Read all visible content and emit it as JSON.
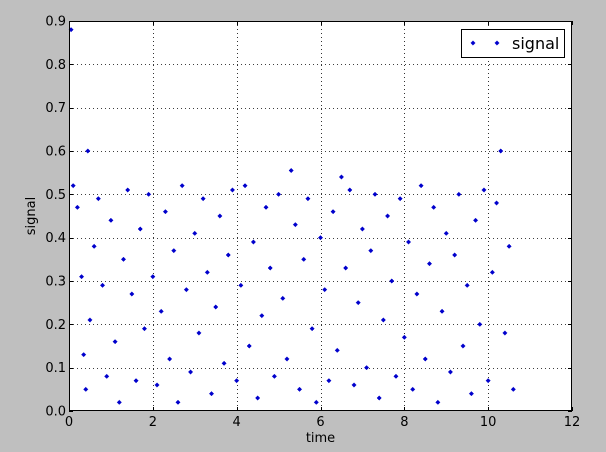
{
  "chart_data": {
    "type": "scatter",
    "xlabel": "time",
    "ylabel": "signal",
    "xlim": [
      0,
      12
    ],
    "ylim": [
      0,
      0.9
    ],
    "xticks": [
      "0",
      "2",
      "4",
      "6",
      "8",
      "10",
      "12"
    ],
    "yticks": [
      "0.0",
      "0.1",
      "0.2",
      "0.3",
      "0.4",
      "0.5",
      "0.6",
      "0.7",
      "0.8",
      "0.9"
    ],
    "grid": true,
    "legend_position": "top-right",
    "marker_color": "#0000cc",
    "series": [
      {
        "name": "signal",
        "marker": "diamond",
        "x_range": [
          0,
          10.65
        ],
        "notable_points": [
          {
            "x": 0.05,
            "y": 0.88
          },
          {
            "x": 0.45,
            "y": 0.6
          },
          {
            "x": 5.3,
            "y": 0.555
          },
          {
            "x": 6.5,
            "y": 0.54
          },
          {
            "x": 10.3,
            "y": 0.6
          }
        ],
        "samples": [
          {
            "x": 0.1,
            "y": 0.52
          },
          {
            "x": 0.2,
            "y": 0.47
          },
          {
            "x": 0.3,
            "y": 0.31
          },
          {
            "x": 0.35,
            "y": 0.13
          },
          {
            "x": 0.4,
            "y": 0.05
          },
          {
            "x": 0.5,
            "y": 0.21
          },
          {
            "x": 0.6,
            "y": 0.38
          },
          {
            "x": 0.7,
            "y": 0.49
          },
          {
            "x": 0.8,
            "y": 0.29
          },
          {
            "x": 0.9,
            "y": 0.08
          },
          {
            "x": 1.0,
            "y": 0.44
          },
          {
            "x": 1.1,
            "y": 0.16
          },
          {
            "x": 1.2,
            "y": 0.02
          },
          {
            "x": 1.3,
            "y": 0.35
          },
          {
            "x": 1.4,
            "y": 0.51
          },
          {
            "x": 1.5,
            "y": 0.27
          },
          {
            "x": 1.6,
            "y": 0.07
          },
          {
            "x": 1.7,
            "y": 0.42
          },
          {
            "x": 1.8,
            "y": 0.19
          },
          {
            "x": 1.9,
            "y": 0.5
          },
          {
            "x": 2.0,
            "y": 0.31
          },
          {
            "x": 2.1,
            "y": 0.06
          },
          {
            "x": 2.2,
            "y": 0.23
          },
          {
            "x": 2.3,
            "y": 0.46
          },
          {
            "x": 2.4,
            "y": 0.12
          },
          {
            "x": 2.5,
            "y": 0.37
          },
          {
            "x": 2.6,
            "y": 0.02
          },
          {
            "x": 2.7,
            "y": 0.52
          },
          {
            "x": 2.8,
            "y": 0.28
          },
          {
            "x": 2.9,
            "y": 0.09
          },
          {
            "x": 3.0,
            "y": 0.41
          },
          {
            "x": 3.1,
            "y": 0.18
          },
          {
            "x": 3.2,
            "y": 0.49
          },
          {
            "x": 3.3,
            "y": 0.32
          },
          {
            "x": 3.4,
            "y": 0.04
          },
          {
            "x": 3.5,
            "y": 0.24
          },
          {
            "x": 3.6,
            "y": 0.45
          },
          {
            "x": 3.7,
            "y": 0.11
          },
          {
            "x": 3.8,
            "y": 0.36
          },
          {
            "x": 3.9,
            "y": 0.51
          },
          {
            "x": 4.0,
            "y": 0.07
          },
          {
            "x": 4.1,
            "y": 0.29
          },
          {
            "x": 4.2,
            "y": 0.52
          },
          {
            "x": 4.3,
            "y": 0.15
          },
          {
            "x": 4.4,
            "y": 0.39
          },
          {
            "x": 4.5,
            "y": 0.03
          },
          {
            "x": 4.6,
            "y": 0.22
          },
          {
            "x": 4.7,
            "y": 0.47
          },
          {
            "x": 4.8,
            "y": 0.33
          },
          {
            "x": 4.9,
            "y": 0.08
          },
          {
            "x": 5.0,
            "y": 0.5
          },
          {
            "x": 5.1,
            "y": 0.26
          },
          {
            "x": 5.2,
            "y": 0.12
          },
          {
            "x": 5.4,
            "y": 0.43
          },
          {
            "x": 5.5,
            "y": 0.05
          },
          {
            "x": 5.6,
            "y": 0.35
          },
          {
            "x": 5.7,
            "y": 0.49
          },
          {
            "x": 5.8,
            "y": 0.19
          },
          {
            "x": 5.9,
            "y": 0.02
          },
          {
            "x": 6.0,
            "y": 0.4
          },
          {
            "x": 6.1,
            "y": 0.28
          },
          {
            "x": 6.2,
            "y": 0.07
          },
          {
            "x": 6.3,
            "y": 0.46
          },
          {
            "x": 6.4,
            "y": 0.14
          },
          {
            "x": 6.6,
            "y": 0.33
          },
          {
            "x": 6.7,
            "y": 0.51
          },
          {
            "x": 6.8,
            "y": 0.06
          },
          {
            "x": 6.9,
            "y": 0.25
          },
          {
            "x": 7.0,
            "y": 0.42
          },
          {
            "x": 7.1,
            "y": 0.1
          },
          {
            "x": 7.2,
            "y": 0.37
          },
          {
            "x": 7.3,
            "y": 0.5
          },
          {
            "x": 7.4,
            "y": 0.03
          },
          {
            "x": 7.5,
            "y": 0.21
          },
          {
            "x": 7.6,
            "y": 0.45
          },
          {
            "x": 7.7,
            "y": 0.3
          },
          {
            "x": 7.8,
            "y": 0.08
          },
          {
            "x": 7.9,
            "y": 0.49
          },
          {
            "x": 8.0,
            "y": 0.17
          },
          {
            "x": 8.1,
            "y": 0.39
          },
          {
            "x": 8.2,
            "y": 0.05
          },
          {
            "x": 8.3,
            "y": 0.27
          },
          {
            "x": 8.4,
            "y": 0.52
          },
          {
            "x": 8.5,
            "y": 0.12
          },
          {
            "x": 8.6,
            "y": 0.34
          },
          {
            "x": 8.7,
            "y": 0.47
          },
          {
            "x": 8.8,
            "y": 0.02
          },
          {
            "x": 8.9,
            "y": 0.23
          },
          {
            "x": 9.0,
            "y": 0.41
          },
          {
            "x": 9.1,
            "y": 0.09
          },
          {
            "x": 9.2,
            "y": 0.36
          },
          {
            "x": 9.3,
            "y": 0.5
          },
          {
            "x": 9.4,
            "y": 0.15
          },
          {
            "x": 9.5,
            "y": 0.29
          },
          {
            "x": 9.6,
            "y": 0.04
          },
          {
            "x": 9.7,
            "y": 0.44
          },
          {
            "x": 9.8,
            "y": 0.2
          },
          {
            "x": 9.9,
            "y": 0.51
          },
          {
            "x": 10.0,
            "y": 0.07
          },
          {
            "x": 10.1,
            "y": 0.32
          },
          {
            "x": 10.2,
            "y": 0.48
          },
          {
            "x": 10.4,
            "y": 0.18
          },
          {
            "x": 10.5,
            "y": 0.38
          },
          {
            "x": 10.6,
            "y": 0.05
          }
        ]
      }
    ]
  }
}
